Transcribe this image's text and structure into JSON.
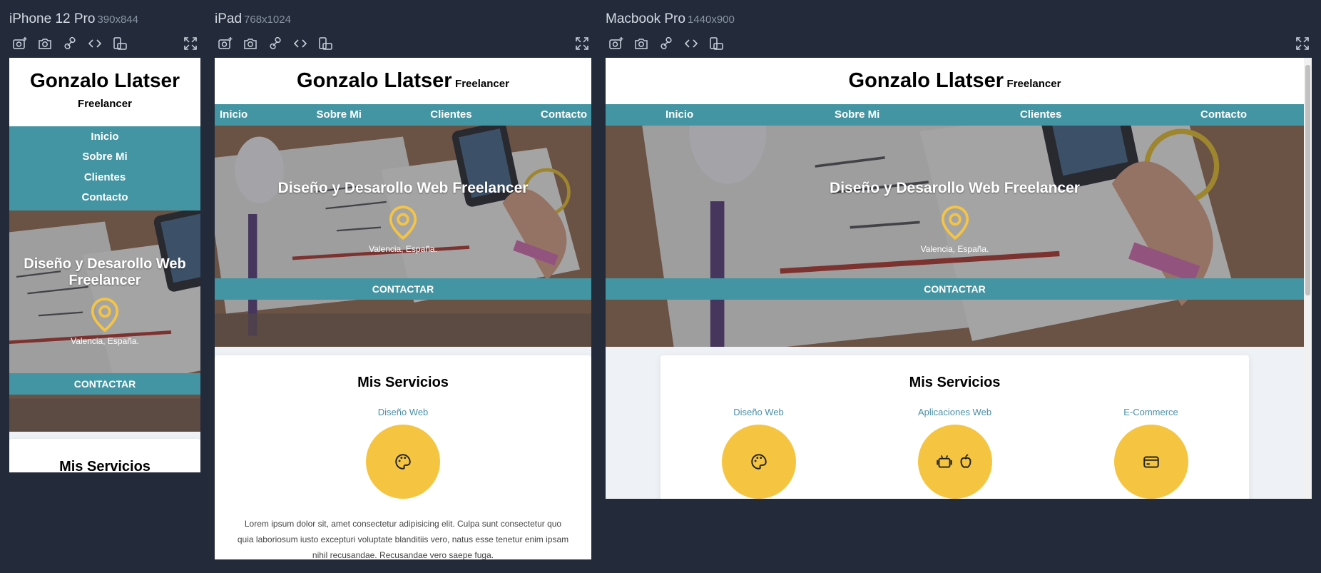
{
  "colors": {
    "background": "#232b3a",
    "accent": "#4495a3",
    "yellow": "#f5c542",
    "service_label": "#4a8fa8"
  },
  "toolbar_icons": [
    "camera-plus-icon",
    "camera-icon",
    "link-icon",
    "code-icon",
    "rotate-device-icon",
    "fullscreen-icon"
  ],
  "devices": [
    {
      "name": "iPhone 12 Pro",
      "size": "390x844"
    },
    {
      "name": "iPad",
      "size": "768x1024"
    },
    {
      "name": "Macbook Pro",
      "size": "1440x900"
    }
  ],
  "site": {
    "name": "Gonzalo Llatser",
    "tagline": "Freelancer",
    "nav": [
      "Inicio",
      "Sobre Mi",
      "Clientes",
      "Contacto"
    ],
    "hero_title": "Diseño y Desarollo Web Freelancer",
    "location": "Valencia, España.",
    "cta": "CONTACTAR",
    "services_title": "Mis Servicios",
    "services": [
      {
        "label": "Diseño Web",
        "icon": "palette-icon"
      },
      {
        "label": "Aplicaciones Web",
        "icon": "android-apple-icon"
      },
      {
        "label": "E-Commerce",
        "icon": "credit-card-icon"
      }
    ],
    "lorem": "Lorem ipsum dolor sit, amet consectetur adipisicing elit. Culpa sunt consectetur quo quia laboriosum iusto excepturi voluptate blanditiis vero, natus esse tenetur enim ipsam nihil recusandae. Recusandae vero saepe fuga."
  }
}
